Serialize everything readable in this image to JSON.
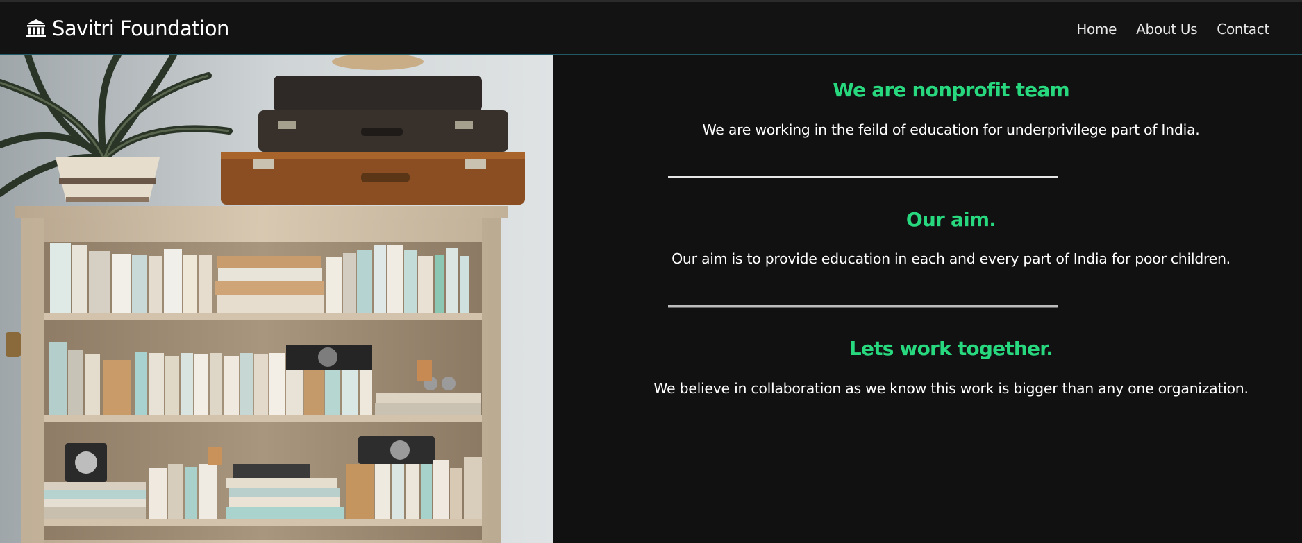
{
  "brand": {
    "name": "Savitri Foundation",
    "icon": "bank-building-icon"
  },
  "nav": {
    "items": [
      {
        "label": "Home"
      },
      {
        "label": "About Us"
      },
      {
        "label": "Contact"
      }
    ]
  },
  "hero_image": {
    "alt": ""
  },
  "sections": [
    {
      "heading": "We are nonprofit team",
      "text": "We are working in the feild of education for underprivilege part of India."
    },
    {
      "heading": "Our aim.",
      "text": "Our aim is to provide education in each and every part of India for poor children."
    },
    {
      "heading": "Lets work together.",
      "text": "We believe in collaboration as we know this work is bigger than any one organization."
    }
  ],
  "colors": {
    "background": "#111111",
    "accent_heading": "#28d87e",
    "text": "#ffffff"
  }
}
